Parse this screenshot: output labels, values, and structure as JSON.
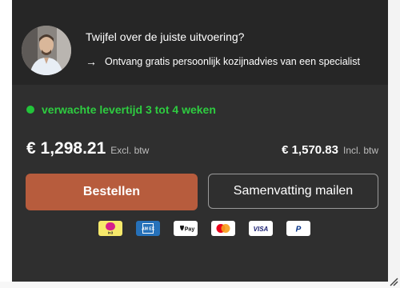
{
  "advice": {
    "title": "Twijfel over de juiste uitvoering?",
    "link_arrow": "→",
    "link_text": "Ontvang gratis persoonlijk kozijnadvies van een specialist"
  },
  "delivery": {
    "text": "verwachte levertijd 3 tot 4 weken",
    "status_color": "#22c43a"
  },
  "pricing": {
    "excl_amount": "€ 1,298.21",
    "excl_label": "Excl. btw",
    "incl_amount": "€ 1,570.83",
    "incl_label": "Incl. btw"
  },
  "actions": {
    "order_label": "Bestellen",
    "mail_label": "Samenvatting mailen",
    "order_color": "#b75c3d"
  },
  "payment_methods": [
    {
      "name": "iDEAL in3",
      "icon": "ideal-in3-icon"
    },
    {
      "name": "American Express",
      "icon": "amex-icon"
    },
    {
      "name": "Apple Pay",
      "icon": "apple-pay-icon"
    },
    {
      "name": "Mastercard",
      "icon": "mastercard-icon"
    },
    {
      "name": "VISA",
      "icon": "visa-icon"
    },
    {
      "name": "PayPal",
      "icon": "paypal-icon"
    }
  ],
  "logos": {
    "in3": "in3",
    "amex": "AM EX",
    "applepay": "Pay",
    "visa": "VISA",
    "paypal": "P"
  }
}
